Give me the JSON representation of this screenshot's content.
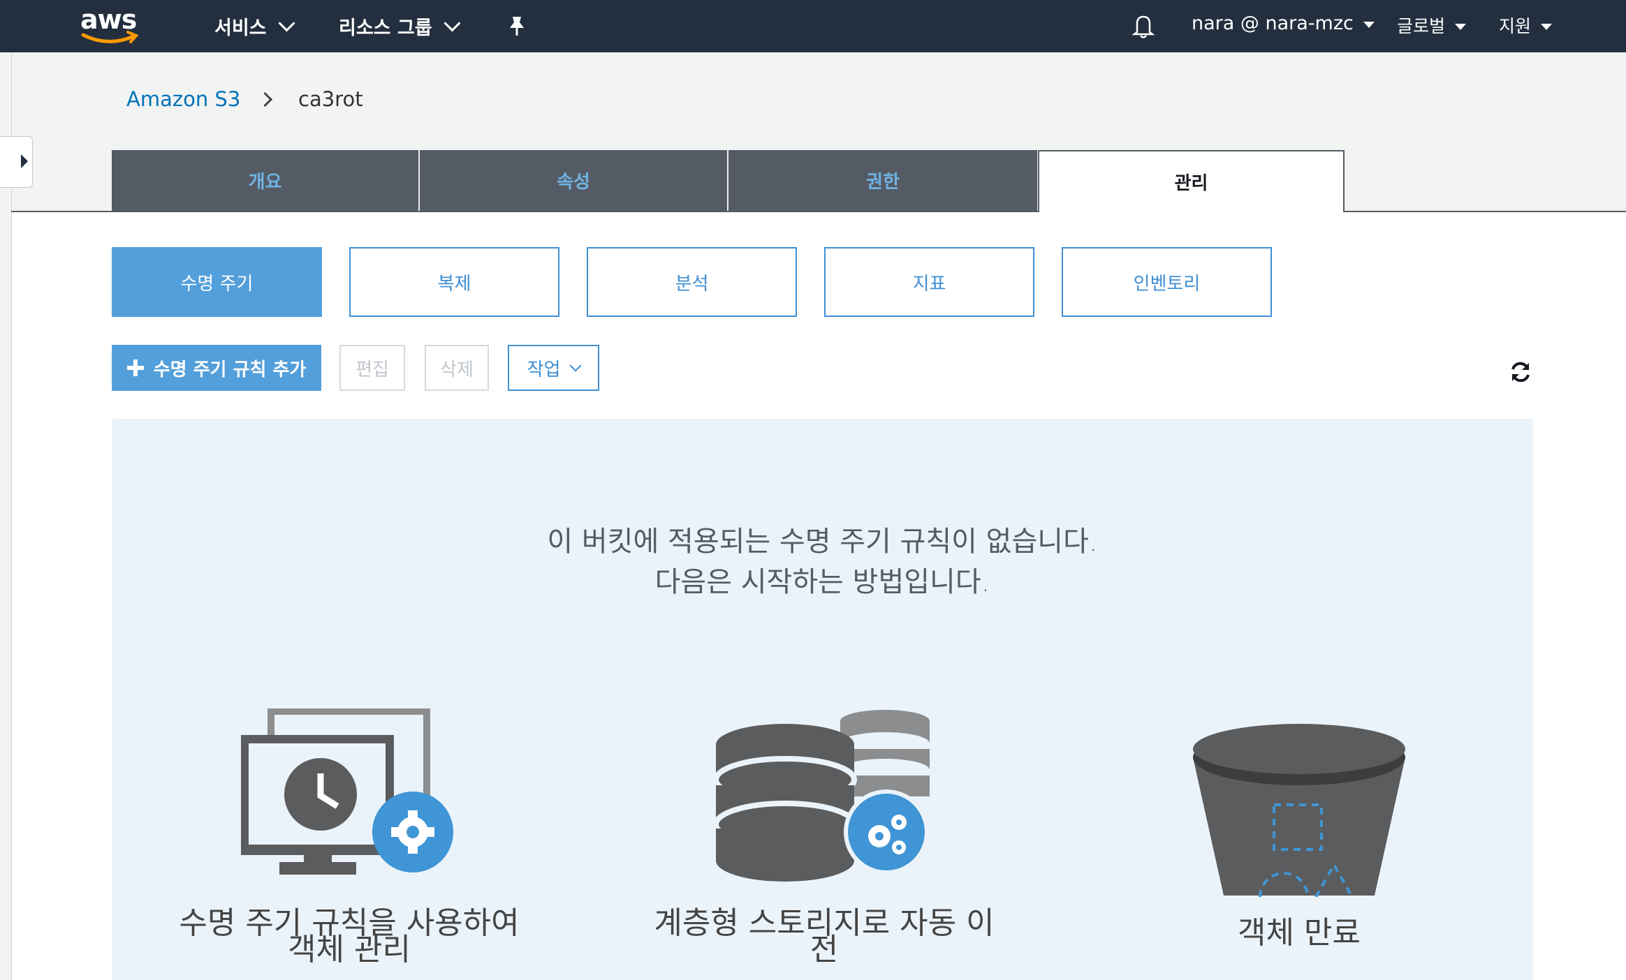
{
  "topnav": {
    "logo": "aws",
    "services": "서비스",
    "resource_groups": "리소스 그룹",
    "pin_icon": "pin-icon",
    "bell_icon": "bell-icon",
    "account": "nara @ nara-mzc",
    "region": "글로벌",
    "support": "지원"
  },
  "breadcrumb": {
    "root": "Amazon S3",
    "current": "ca3rot"
  },
  "tabs": [
    {
      "label": "개요",
      "active": false
    },
    {
      "label": "속성",
      "active": false
    },
    {
      "label": "권한",
      "active": false
    },
    {
      "label": "관리",
      "active": true
    }
  ],
  "subtabs": [
    {
      "label": "수명 주기",
      "active": true
    },
    {
      "label": "복제",
      "active": false
    },
    {
      "label": "분석",
      "active": false
    },
    {
      "label": "지표",
      "active": false
    },
    {
      "label": "인벤토리",
      "active": false
    }
  ],
  "actions": {
    "add_rule": "수명 주기 규칙 추가",
    "edit": "편집",
    "delete": "삭제",
    "actions": "작업"
  },
  "empty_state": {
    "line1": "이 버킷에 적용되는 수명 주기 규칙이 없습니다.",
    "line2": "다음은 시작하는 방법입니다."
  },
  "features": [
    {
      "line1": "수명 주기 규칙을 사용하여",
      "line2": "객체 관리",
      "icon": "lifecycle-monitor-icon"
    },
    {
      "line1": "계층형 스토리지로 자동 이",
      "line2": "전",
      "icon": "tiered-storage-icon"
    },
    {
      "line1": "객체 만료",
      "line2": "",
      "icon": "bucket-expiration-icon"
    }
  ],
  "colors": {
    "nav_bg": "#232f3e",
    "accent": "#539fdb",
    "tab_dark": "#545b64",
    "panel_bg": "#ebf3fa",
    "link": "#0073bb"
  }
}
